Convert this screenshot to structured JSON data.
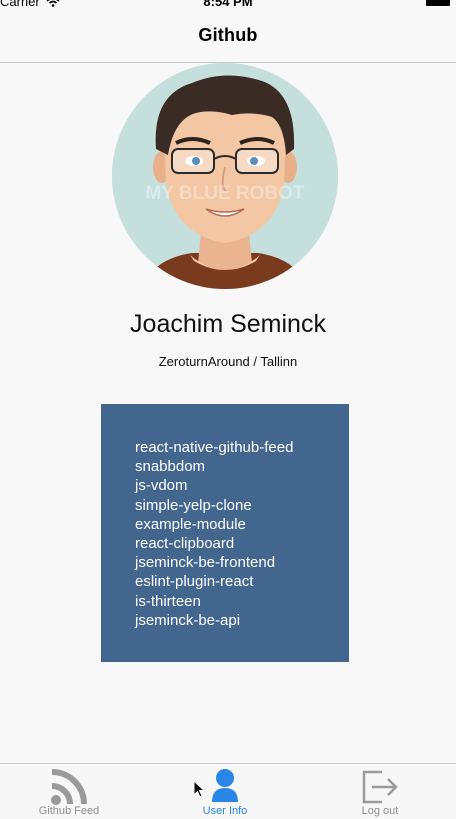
{
  "status_bar": {
    "carrier": "Carrier",
    "time": "8:54 PM"
  },
  "nav": {
    "title": "Github"
  },
  "profile": {
    "watermark": "MY BLUE ROBOT",
    "name": "Joachim Seminck",
    "location": "ZeroturnAround / Tallinn"
  },
  "repos": [
    "react-native-github-feed",
    "snabbdom",
    "js-vdom",
    "simple-yelp-clone",
    "example-module",
    "react-clipboard",
    "jseminck-be-frontend",
    "eslint-plugin-react",
    "is-thirteen",
    "jseminck-be-api"
  ],
  "tabs": [
    {
      "label": "Github Feed",
      "icon": "rss-feed-icon",
      "active": false
    },
    {
      "label": "User Info",
      "icon": "person-icon",
      "active": true
    },
    {
      "label": "Log out",
      "icon": "logout-icon",
      "active": false
    }
  ],
  "colors": {
    "accent": "#2a86e6",
    "card": "#43668f",
    "tab_inactive": "#8e8e93"
  }
}
